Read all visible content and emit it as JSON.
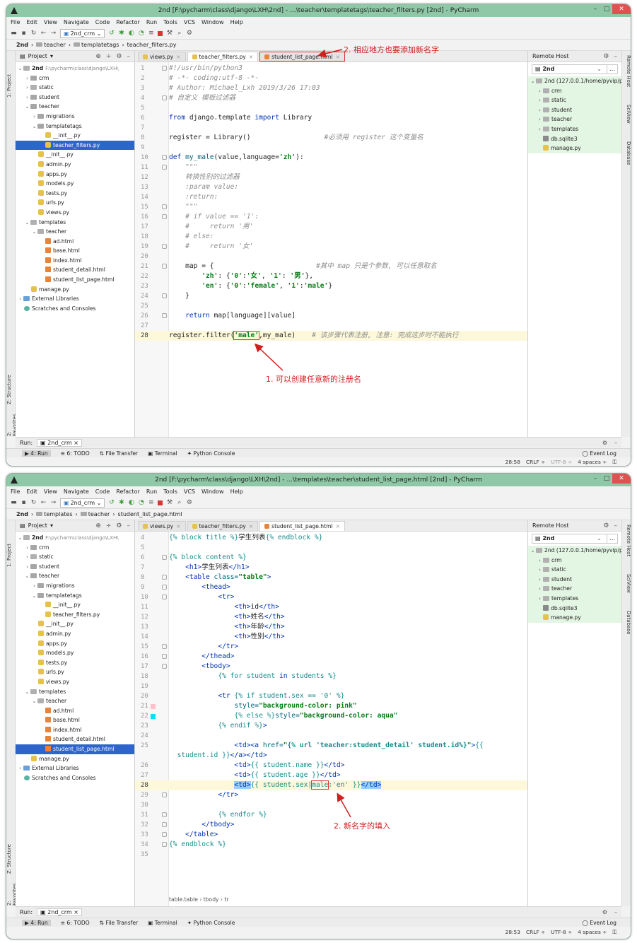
{
  "colors": {
    "accent": "#8ec8a6",
    "annotation": "#d02020",
    "selection": "#2f65ca",
    "remote_bg": "#e3f5e3"
  },
  "menu": [
    "File",
    "Edit",
    "View",
    "Navigate",
    "Code",
    "Refactor",
    "Run",
    "Tools",
    "VCS",
    "Window",
    "Help"
  ],
  "common": {
    "run_config": "2nd_crm",
    "project_label": "Project",
    "remote_title": "Remote Host",
    "remote_server": "2nd",
    "remote_root": "2nd (127.0.0.1/home/pyvip/p",
    "remote_items": [
      "crm",
      "static",
      "student",
      "teacher",
      "templates",
      "db.sqlite3",
      "manage.py"
    ],
    "run_label": "Run:",
    "run_tab": "2nd_crm",
    "tools": [
      "4: Run",
      "6: TODO",
      "File Transfer",
      "Terminal",
      "Python Console"
    ],
    "event_log": "Event Log",
    "side_left": [
      "1: Project",
      "Z: Structure",
      "2: Favorites"
    ],
    "side_right": [
      "Remote Host",
      "SciView",
      "Database"
    ],
    "tree": {
      "root": "2nd",
      "root_path": "F:\\pycharm\\class\\django\\LXH\\",
      "crm": "crm",
      "static": "static",
      "student": "student",
      "teacher": "teacher",
      "migrations": "migrations",
      "templatetags": "templatetags",
      "init": "__init__.py",
      "teacher_filters": "teacher_filters.py",
      "admin": "admin.py",
      "apps": "apps.py",
      "models": "models.py",
      "tests": "tests.py",
      "urls": "urls.py",
      "views": "views.py",
      "templates": "templates",
      "ad": "ad.html",
      "base": "base.html",
      "index": "index.html",
      "student_detail": "student_detail.html",
      "student_list_page": "student_list_page.html",
      "manage": "manage.py",
      "ext_libs": "External Libraries",
      "scratches": "Scratches and Consoles"
    },
    "tabs": [
      "views.py",
      "teacher_filters.py",
      "student_list_page.html"
    ]
  },
  "top": {
    "title": "2nd [F:\\pycharm\\class\\django\\LXH\\2nd] - ...\\teacher\\templatetags\\teacher_filters.py [2nd] - PyCharm",
    "breadcrumb": [
      "2nd",
      "teacher",
      "templatetags",
      "teacher_filters.py"
    ],
    "status": {
      "pos": "28:58",
      "crlf": "CRLF ÷",
      "encoding": "UTF-8 ÷",
      "indent": "4 spaces ÷"
    },
    "annotation_1": "1. 可以创建任意新的注册名",
    "annotation_2": "2. 相应地方也要添加新名字"
  },
  "bottom": {
    "title": "2nd [F:\\pycharm\\class\\django\\LXH\\2nd] - ...\\templates\\teacher\\student_list_page.html [2nd] - PyCharm",
    "breadcrumb": [
      "2nd",
      "templates",
      "teacher",
      "student_list_page.html"
    ],
    "status": {
      "pos": "28:53",
      "crlf": "CRLF ÷",
      "encoding": "UTF-8 ÷",
      "indent": "4 spaces ÷"
    },
    "editor_breadcrumb": "table.table  ›  tbody  ›  tr",
    "annotation": "2. 新名字的填入"
  }
}
